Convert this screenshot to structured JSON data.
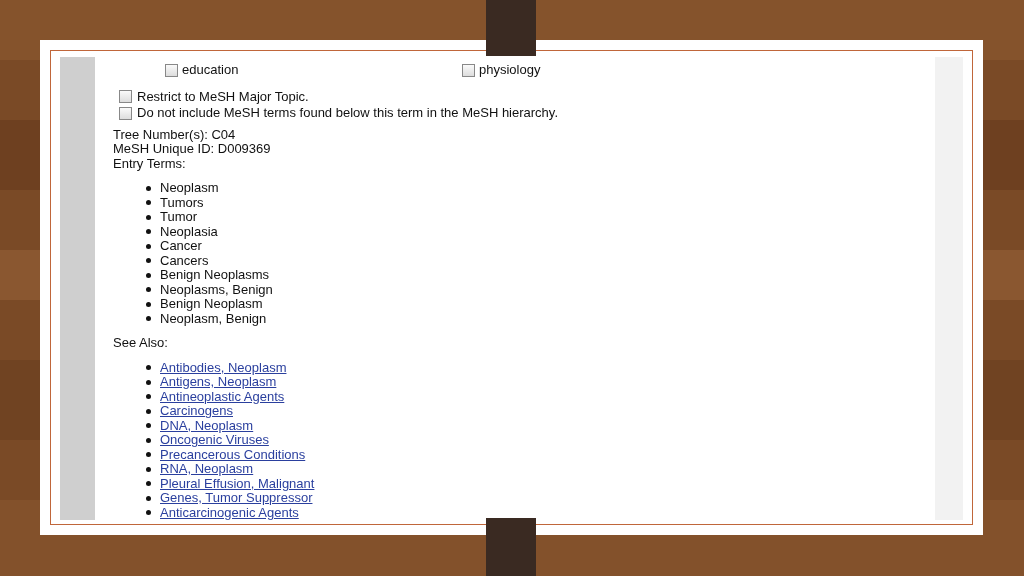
{
  "subheading_options": [
    {
      "label": "education",
      "checked": false
    },
    {
      "label": "physiology",
      "checked": false
    }
  ],
  "options": [
    {
      "label": "Restrict to MeSH Major Topic.",
      "checked": false
    },
    {
      "label": "Do not include MeSH terms found below this term in the MeSH hierarchy.",
      "checked": false
    }
  ],
  "details": [
    "Tree Number(s): C04",
    "MeSH Unique ID: D009369",
    "Entry Terms:"
  ],
  "entry_terms": [
    "Neoplasm",
    "Tumors",
    "Tumor",
    "Neoplasia",
    "Cancer",
    "Cancers",
    "Benign Neoplasms",
    "Neoplasms, Benign",
    "Benign Neoplasm",
    "Neoplasm, Benign"
  ],
  "see_also_heading": "See Also:",
  "see_also": [
    "Antibodies, Neoplasm",
    "Antigens, Neoplasm",
    "Antineoplastic Agents",
    "Carcinogens",
    "DNA, Neoplasm",
    "Oncogenic Viruses",
    "Precancerous Conditions",
    "RNA, Neoplasm",
    "Pleural Effusion, Malignant",
    "Genes, Tumor Suppressor",
    "Anticarcinogenic Agents"
  ]
}
